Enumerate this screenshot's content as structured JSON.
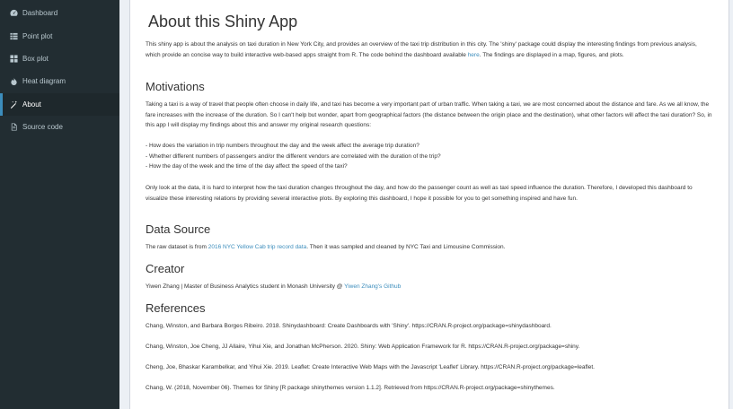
{
  "sidebar": {
    "items": [
      {
        "label": "Dashboard",
        "icon": "dashboard-icon"
      },
      {
        "label": "Point plot",
        "icon": "grid-icon"
      },
      {
        "label": "Box plot",
        "icon": "table-icon"
      },
      {
        "label": "Heat diagram",
        "icon": "fire-icon"
      },
      {
        "label": "About",
        "icon": "wand-icon"
      },
      {
        "label": "Source code",
        "icon": "file-icon"
      }
    ],
    "active": "About"
  },
  "main": {
    "title": "About this Shiny App",
    "intro_before": "This shiny app is about the analysis on taxi duration in New York City, and provides an overview of the taxi trip distribution in this city. The 'shiny' package could display the interesting findings from previous analysis, which provide an concise way to build interactive web-based apps straight from R. The code behind the dashboard available ",
    "intro_link": "here",
    "intro_after": ". The findings are displayed in a map, figures, and plots.",
    "motivations_heading": "Motivations",
    "motivations_p1": "Taking a taxi is a way of travel that people often choose in daily life, and taxi has become a very important part of urban traffic. When taking a taxi, we are most concerned about the distance and fare. As we all know, the fare increases with the increase of the duration. So I can't help but wonder, apart from geographical factors (the distance between the origin place and the destination), what other factors will affect the taxi duration? So, in this app I will display my findings about this and answer my original research questions:",
    "questions": [
      "- How does the variation in trip numbers throughout the day and the week affect the average trip duration?",
      "- Whether different numbers of passengers and/or the different vendors are correlated with the duration of the trip?",
      "- How the day of the week and the time of the day affect the speed of the taxi?"
    ],
    "motivations_p2": "Only look at the data, it is hard to interpret how the taxi duration changes throughout the day, and how do the passenger count as well as taxi speed influence the duration. Therefore, I developed this dashboard to visualize these interesting relations by providing several interactive plots. By exploring this dashboard, I hope it possible for you to get something inspired and have fun.",
    "datasource_heading": "Data Source",
    "datasource_before": "The raw dataset is from ",
    "datasource_link": "2016 NYC Yellow Cab trip record data",
    "datasource_after": ". Then it was sampled and cleaned by NYC Taxi and Limousine Commission.",
    "creator_heading": "Creator",
    "creator_before": "Yiwen Zhang | Master of Business Analytics student in Monash University @ ",
    "creator_link": "Yiwen Zhang's Github",
    "references_heading": "References",
    "references": [
      "Chang, Winston, and Barbara Borges Ribeiro. 2018. Shinydashboard: Create Dashboards with 'Shiny'. https://CRAN.R-project.org/package=shinydashboard.",
      "Chang, Winston, Joe Cheng, JJ Allaire, Yihui Xie, and Jonathan McPherson. 2020. Shiny: Web Application Framework for R. https://CRAN.R-project.org/package=shiny.",
      "Cheng, Joe, Bhaskar Karambelkar, and Yihui Xie. 2019. Leaflet: Create Interactive Web Maps with the Javascript 'Leaflet' Library. https://CRAN.R-project.org/package=leaflet.",
      "Chang, W. (2018, November 06). Themes for Shiny [R package shinythemes version 1.1.2]. Retrieved from https://CRAN.R-project.org/package=shinythemes."
    ]
  },
  "colors": {
    "sidebar_bg": "#222d32",
    "sidebar_active_bg": "#1e282c",
    "link": "#3c8dbc",
    "content_bg": "#ecf0f5"
  }
}
